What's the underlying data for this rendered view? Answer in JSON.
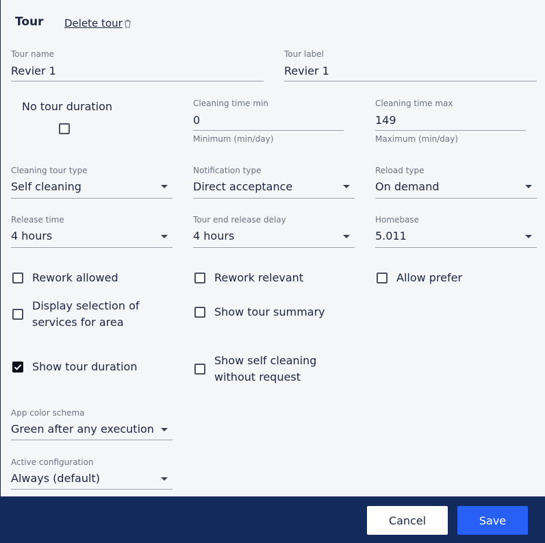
{
  "header": {
    "title": "Tour",
    "delete_label": "Delete tour"
  },
  "fields": {
    "tour_name": {
      "label": "Tour name",
      "value": "Revier 1"
    },
    "tour_label": {
      "label": "Tour label",
      "value": "Revier 1"
    },
    "no_tour_duration": {
      "label": "No tour duration",
      "checked": false
    },
    "cleaning_min": {
      "label": "Cleaning time min",
      "value": "0",
      "helper": "Minimum (min/day)"
    },
    "cleaning_max": {
      "label": "Cleaning time max",
      "value": "149",
      "helper": "Maximum (min/day)"
    },
    "cleaning_tour_type": {
      "label": "Cleaning tour type",
      "value": "Self cleaning"
    },
    "notification_type": {
      "label": "Notification type",
      "value": "Direct acceptance"
    },
    "reload_type": {
      "label": "Reload type",
      "value": "On demand"
    },
    "release_time": {
      "label": "Release time",
      "value": "4 hours"
    },
    "tour_end_release_delay": {
      "label": "Tour end release delay",
      "value": "4 hours"
    },
    "homebase": {
      "label": "Homebase",
      "value": "5.011"
    },
    "app_color_schema": {
      "label": "App color schema",
      "value": "Green after any execution"
    },
    "active_configuration": {
      "label": "Active configuration",
      "value": "Always (default)"
    }
  },
  "checkboxes": {
    "rework_allowed": {
      "label": "Rework allowed",
      "checked": false
    },
    "rework_relevant": {
      "label": "Rework relevant",
      "checked": false
    },
    "allow_prefer": {
      "label": "Allow prefer",
      "checked": false
    },
    "display_selection_line1": "Display selection of",
    "display_selection_line2": "services for area",
    "display_selection_checked": false,
    "show_tour_summary": {
      "label": "Show tour summary",
      "checked": false
    },
    "show_tour_duration": {
      "label": "Show tour duration",
      "checked": true
    },
    "show_self_cleaning_line1": "Show self cleaning",
    "show_self_cleaning_line2": "without request",
    "show_self_cleaning_checked": false
  },
  "footer": {
    "cancel_label": "Cancel",
    "save_label": "Save"
  },
  "colors": {
    "footer_bg": "#132a5c",
    "save_bg": "#2860f6",
    "page_bg": "#f5f6f8"
  },
  "icons": [
    "trash-icon",
    "dropdown-arrow-icon",
    "checkmark-icon"
  ]
}
